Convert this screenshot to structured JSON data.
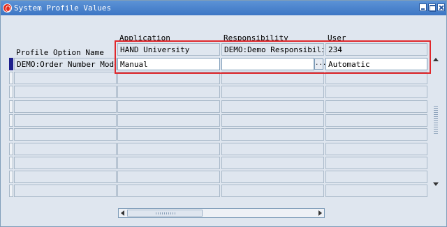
{
  "window": {
    "title": "System Profile Values"
  },
  "headers": {
    "profile_option_name": "Profile Option Name",
    "application": "Application",
    "responsibility": "Responsibility",
    "user": "User"
  },
  "context_row": {
    "application": "HAND University",
    "responsibility": "DEMO:Demo Responsibility",
    "user": "234"
  },
  "current_row": {
    "profile_option": "DEMO:Order Number Mode",
    "application_value": "Manual",
    "responsibility_value": "",
    "user_value": "Automatic",
    "lov_button": "..."
  },
  "empty_rows": 9,
  "colors": {
    "highlight": "#e0272b",
    "active_indicator": "#1d1f8c",
    "titlebar": "#3d76c4"
  }
}
